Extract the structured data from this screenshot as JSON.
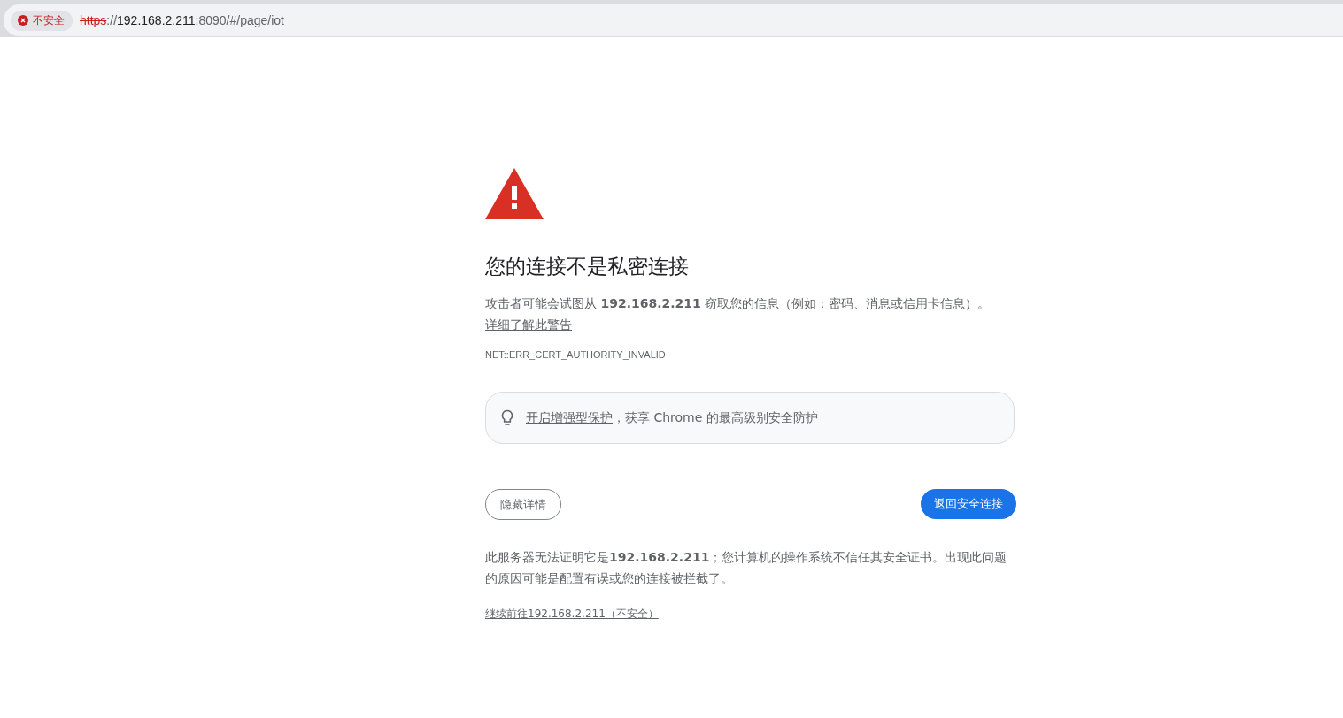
{
  "address_bar": {
    "security_chip": "不安全",
    "url": {
      "scheme": "https",
      "separator": "://",
      "host": "192.168.2.211",
      "rest": ":8090/#/page/iot"
    }
  },
  "heading": "您的连接不是私密连接",
  "message": "攻击者可能会试图从 **192.168.2.211** 窃取您的信息（例如：密码、消息或信用卡信息）。",
  "learn_more_link": "详细了解此警告",
  "error_code": "NET::ERR_CERT_AUTHORITY_INVALID",
  "protection_card": {
    "link": "开启增强型保护",
    "text": "，获享 Chrome 的最高级别安全防护"
  },
  "buttons": {
    "hide_details": "隐藏详情",
    "back_to_safety": "返回安全连接"
  },
  "details": "此服务器无法证明它是**192.168.2.211**；您计算机的操作系统不信任其安全证书。出现此问题的原因可能是配置有误或您的连接被拦截了。",
  "proceed_link": "继续前往192.168.2.211（不安全）"
}
